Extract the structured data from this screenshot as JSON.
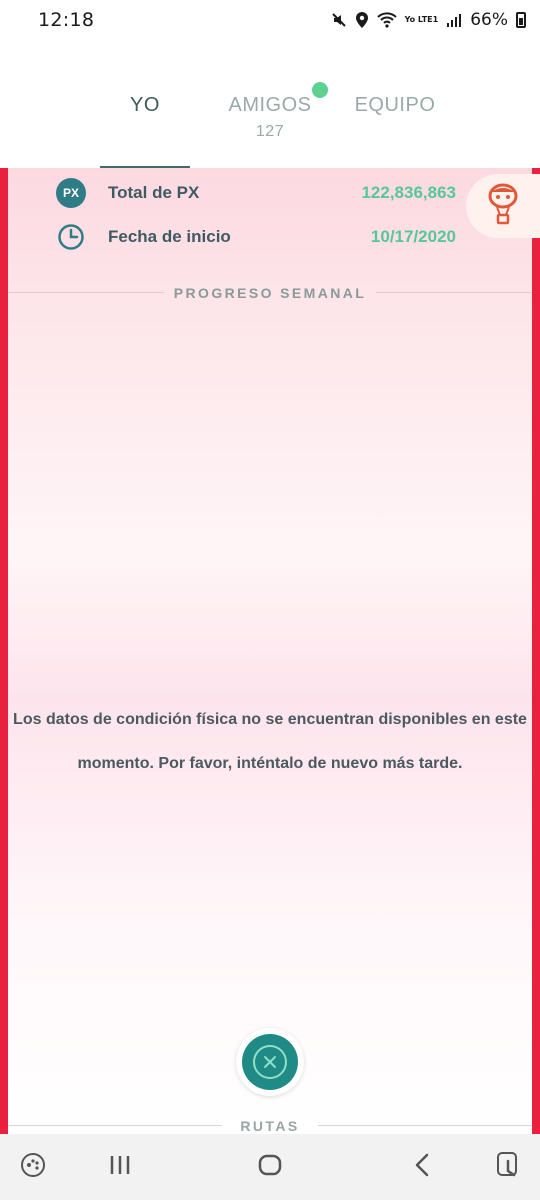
{
  "status_bar": {
    "time": "12:18",
    "network_label": "Yo LTE1",
    "battery": "66%"
  },
  "tabs": {
    "yo": "YO",
    "amigos": "AMIGOS",
    "amigos_count": "127",
    "equipo": "EQUIPO"
  },
  "stats": {
    "xp_badge": "PX",
    "xp_label": "Total de PX",
    "xp_value": "122,836,863",
    "start_label": "Fecha de inicio",
    "start_value": "10/17/2020"
  },
  "weekly": {
    "title": "PROGRESO SEMANAL",
    "message": "Los datos de condición física no se encuentran disponibles en este momento. Por favor, inténtalo de nuevo más tarde."
  },
  "routes": {
    "label": "RUTAS"
  },
  "colors": {
    "accent_green": "#57c69a",
    "edge_red": "#e8213f",
    "teal": "#1f8a86",
    "notification_dot": "#5dd191"
  },
  "icons": {
    "clock": "clock-icon",
    "balloon": "balloon-icon",
    "close": "close-icon"
  }
}
